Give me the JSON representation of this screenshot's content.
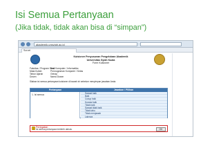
{
  "slide": {
    "title": "Isi Semua Pertanyaan",
    "subtitle": "(Jika tidak, tidak akan bisa di “simpan”)"
  },
  "colors": {
    "title": "#3a9e3a",
    "table_header": "#3f74ab",
    "popup_border": "#d02828"
  },
  "browser": {
    "url": "akademik.unsyiah.ac.id",
    "tab_label": "Survei"
  },
  "form": {
    "header_lines": [
      "Kuisioner Penyusunan Pengelolaan Akademik",
      "Universitas Syiah Kuala",
      "Form Kuisioner"
    ],
    "info": [
      {
        "label": "Fakultas / Program Studi",
        "value": "Ilmu Komputer / Informatika"
      },
      {
        "label": "Mata Kuliah",
        "value": "Pemrograman Komputer / Kelas"
      },
      {
        "label": "Tahun Ajaran",
        "value": "Genap"
      },
      {
        "label": "Dosen",
        "value": "Nama Dosen"
      }
    ],
    "notice": "Silakan isi semua pertanyaan kuisioner di bawah ini sebelum menyimpan jawaban Anda.",
    "table": {
      "col_left": "Pertanyaan",
      "col_right": "Jawaban / Pilihan",
      "left_cell": "1. Isi semua",
      "items": [
        "Sangat baik",
        "Baik",
        "Cukup baik",
        "Kurang baik",
        "Tidak baik",
        "Sangat tidak baik",
        "Tidak tahu",
        "Tidak menjawab",
        "Lainnya"
      ]
    },
    "popup": {
      "title": "Peringatan",
      "text": "Isi semua pertanyaan terlebih dahulu",
      "button": "OK"
    }
  }
}
